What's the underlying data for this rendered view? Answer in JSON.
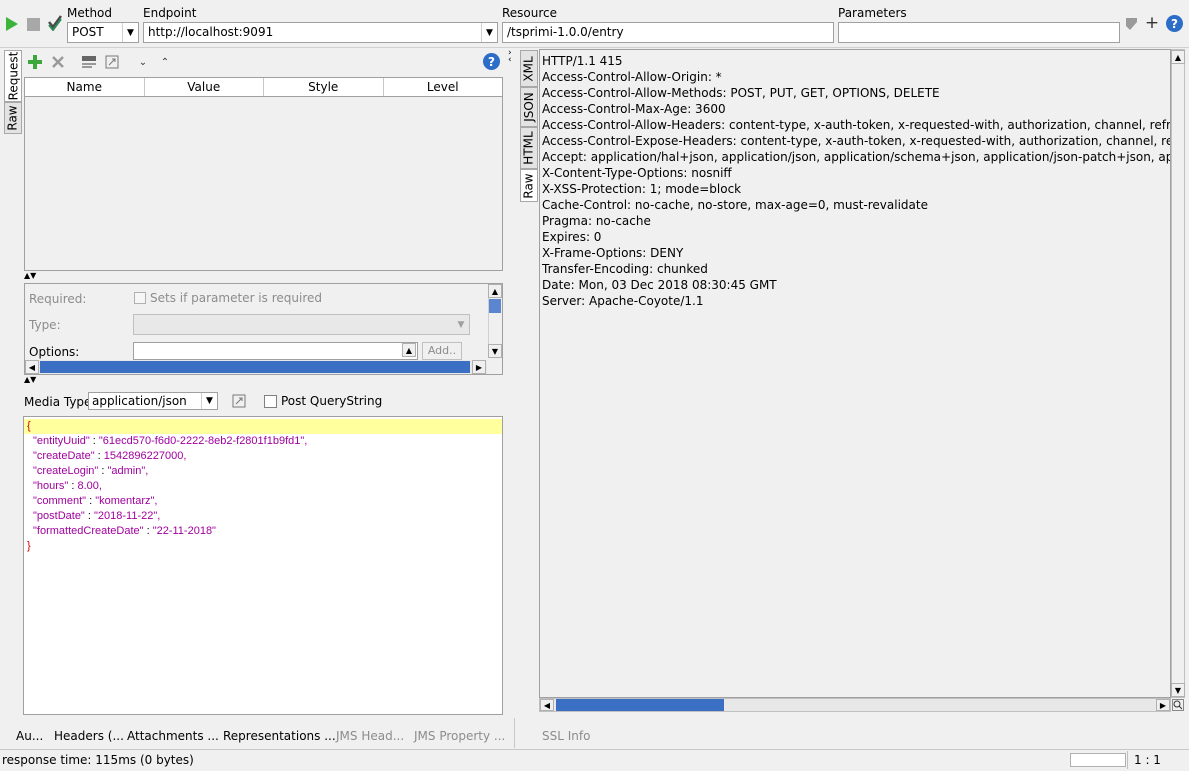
{
  "toolbar": {
    "method_label": "Method",
    "method_value": "POST",
    "endpoint_label": "Endpoint",
    "endpoint_value": "http://localhost:9091",
    "resource_label": "Resource",
    "resource_value": "/tsprimi-1.0.0/entry",
    "parameters_label": "Parameters",
    "parameters_value": "",
    "help_glyph": "?",
    "add_glyph": "+"
  },
  "request": {
    "side_tabs": [
      "Request",
      "Raw"
    ],
    "table_columns": [
      "Name",
      "Value",
      "Style",
      "Level"
    ],
    "help_glyph": "?",
    "details": {
      "required_label": "Required:",
      "required_checkbox_label": "Sets if parameter is required",
      "type_label": "Type:",
      "options_label": "Options:",
      "add_button": "Add.."
    },
    "media_type_label": "Media Type",
    "media_type_value": "application/json",
    "post_querystring_label": "Post QueryString",
    "body": {
      "open_brace": "{",
      "close_brace": "}",
      "entries": [
        {
          "key": "\"entityUuid\"",
          "value": "\"61ecd570-f6d0-2222-8eb2-f2801f1b9fd1\","
        },
        {
          "key": "\"createDate\"",
          "value": "1542896227000,"
        },
        {
          "key": "\"createLogin\"",
          "value": "\"admin\","
        },
        {
          "key": "\"hours\"",
          "value": "8.00,"
        },
        {
          "key": "\"comment\"",
          "value": "\"komentarz\","
        },
        {
          "key": "\"postDate\"",
          "value": "\"2018-11-22\","
        },
        {
          "key": "\"formattedCreateDate\"",
          "value": "\"22-11-2018\""
        }
      ],
      "separator": " : "
    },
    "bottom_tabs": [
      "Au...",
      "Headers (...",
      "Attachments ...",
      "Representations ...",
      "JMS Head...",
      "JMS Property ..."
    ]
  },
  "response": {
    "side_tabs": [
      "XML",
      "JSON",
      "HTML",
      "Raw"
    ],
    "lines": [
      "HTTP/1.1 415",
      "Access-Control-Allow-Origin: *",
      "Access-Control-Allow-Methods: POST, PUT, GET, OPTIONS, DELETE",
      "Access-Control-Max-Age: 3600",
      "Access-Control-Allow-Headers: content-type, x-auth-token, x-requested-with, authorization, channel, refresh, origin",
      "Access-Control-Expose-Headers: content-type, x-auth-token, x-requested-with, authorization, channel, refresh, origin",
      "Accept: application/hal+json, application/json, application/schema+json, application/json-patch+json, application/merge-patch+json",
      "X-Content-Type-Options: nosniff",
      "X-XSS-Protection: 1; mode=block",
      "Cache-Control: no-cache, no-store, max-age=0, must-revalidate",
      "Pragma: no-cache",
      "Expires: 0",
      "X-Frame-Options: DENY",
      "Transfer-Encoding: chunked",
      "Date: Mon, 03 Dec 2018 08:30:45 GMT",
      "Server: Apache-Coyote/1.1"
    ],
    "bottom_tab": "SSL Info"
  },
  "status": {
    "response_time": "response time: 115ms (0 bytes)",
    "position": "1 : 1"
  }
}
